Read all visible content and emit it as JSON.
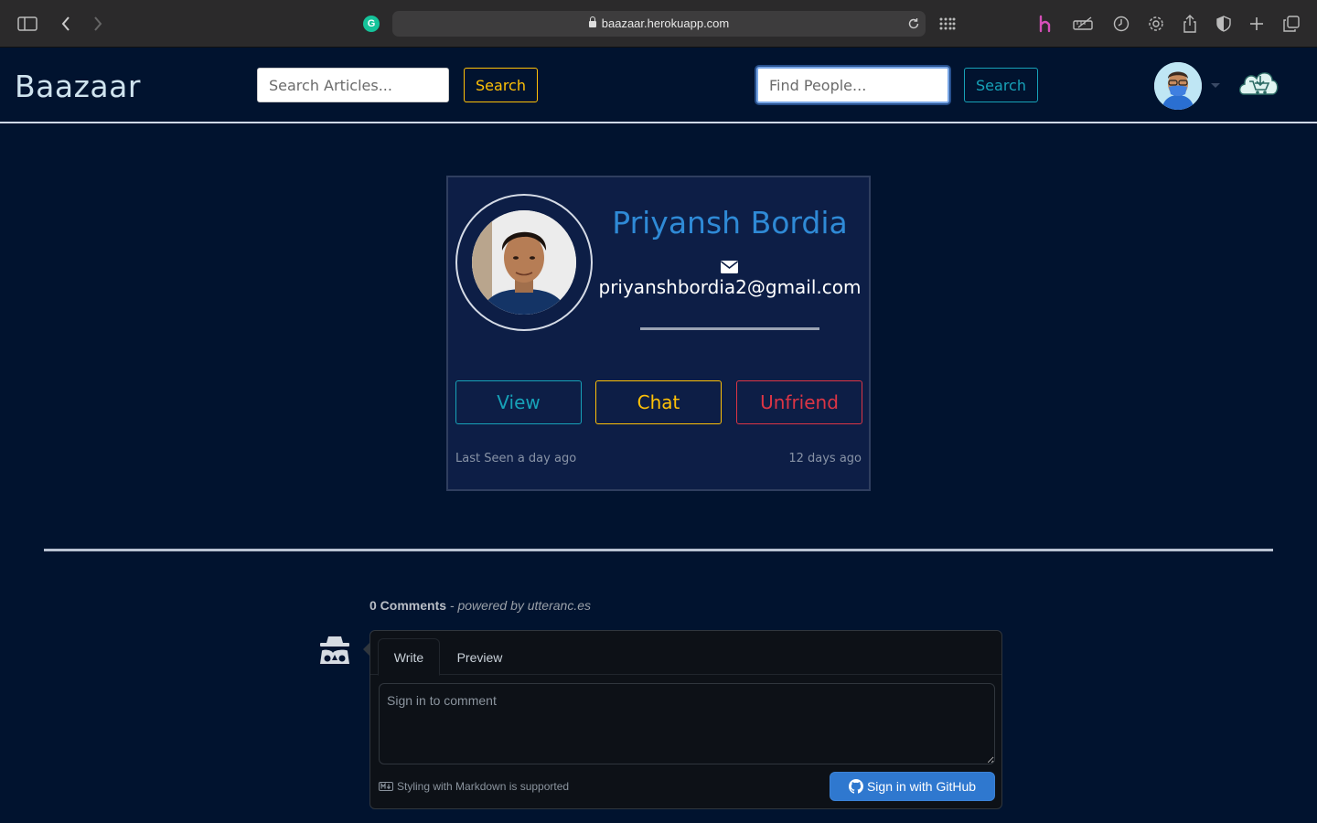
{
  "browser": {
    "url": "baazaar.herokuapp.com",
    "grammarly_letter": "G"
  },
  "navbar": {
    "brand": "Baazaar",
    "article_search": {
      "placeholder": "Search Articles...",
      "button": "Search"
    },
    "people_search": {
      "placeholder": "Find People...",
      "button": "Search"
    }
  },
  "profile": {
    "name": "Priyansh Bordia",
    "email": "priyanshbordia2@gmail.com",
    "buttons": {
      "view": "View",
      "chat": "Chat",
      "unfriend": "Unfriend"
    },
    "last_seen": "Last Seen a day ago",
    "friends_since": "12 days ago"
  },
  "comments": {
    "count_label": "0 Comments",
    "powered_by": "- powered by utteranc.es",
    "tabs": [
      "Write",
      "Preview"
    ],
    "textarea_placeholder": "Sign in to comment",
    "markdown_note": "Styling with Markdown is supported",
    "signin_button": "Sign in with GitHub"
  },
  "colors": {
    "background": "#01132f",
    "card": "#0d1e46",
    "name": "#2f8ad6",
    "info": "#17a2b8",
    "warning": "#ffc107",
    "danger": "#dc3545",
    "github_button": "#2f78cf"
  },
  "icons": {
    "sidebar": "sidebar-icon",
    "back": "chevron-left-icon",
    "forward": "chevron-right-icon",
    "grid": "grid-icon",
    "reload": "reload-icon",
    "mail": "envelope-icon",
    "github": "github-icon",
    "markdown": "markdown-icon",
    "anonymous": "anonymous-icon"
  }
}
